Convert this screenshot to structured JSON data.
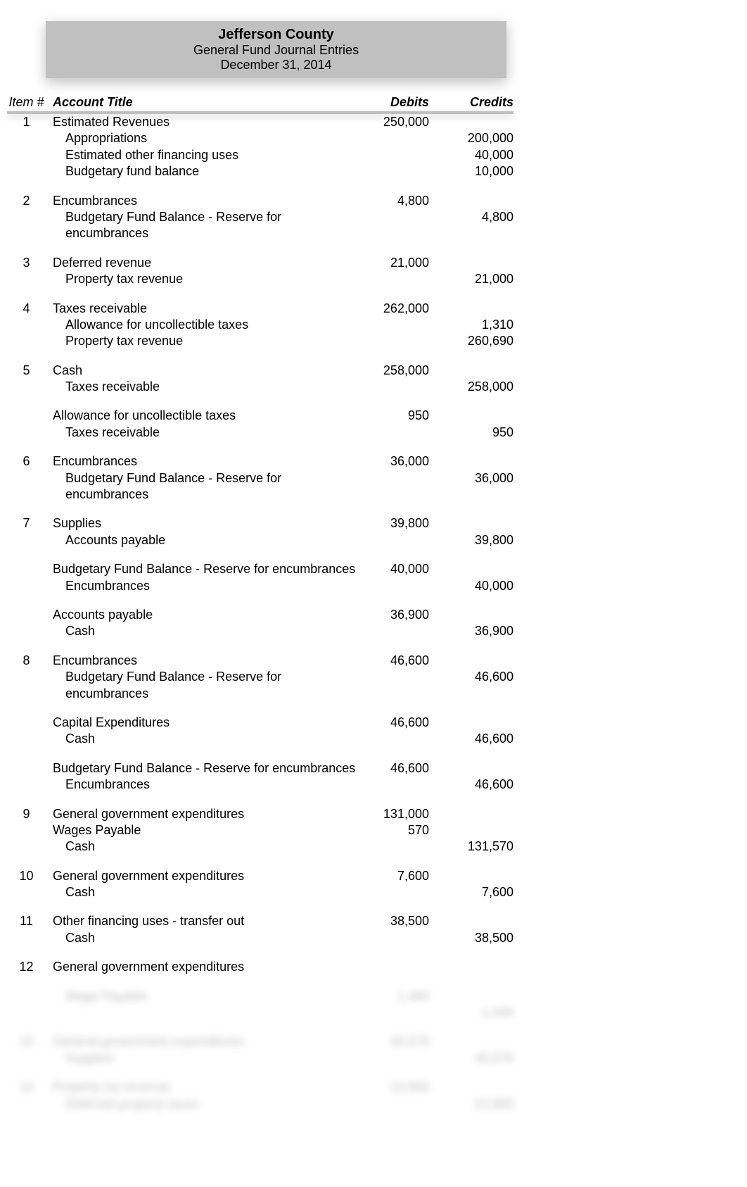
{
  "header": {
    "line1": "Jefferson County",
    "line2": "General Fund Journal Entries",
    "line3": "December 31, 2014"
  },
  "columns": {
    "item": "Item #",
    "title": "Account Title",
    "debit": "Debits",
    "credit": "Credits"
  },
  "entries": [
    {
      "item": "1",
      "rows": [
        {
          "title": "Estimated Revenues",
          "debit": "250,000",
          "credit": "",
          "indent": 0
        },
        {
          "title": "Appropriations",
          "debit": "",
          "credit": "200,000",
          "indent": 1
        },
        {
          "title": "Estimated other financing uses",
          "debit": "",
          "credit": "40,000",
          "indent": 1
        },
        {
          "title": "Budgetary fund balance",
          "debit": "",
          "credit": "10,000",
          "indent": 1
        }
      ]
    },
    {
      "item": "2",
      "rows": [
        {
          "title": "Encumbrances",
          "debit": "4,800",
          "credit": "",
          "indent": 0
        },
        {
          "title": "Budgetary Fund Balance - Reserve for encumbrances",
          "debit": "",
          "credit": "4,800",
          "indent": 1
        }
      ]
    },
    {
      "item": "3",
      "rows": [
        {
          "title": "Deferred revenue",
          "debit": "21,000",
          "credit": "",
          "indent": 0
        },
        {
          "title": "Property tax revenue",
          "debit": "",
          "credit": "21,000",
          "indent": 1
        }
      ]
    },
    {
      "item": "4",
      "rows": [
        {
          "title": "Taxes receivable",
          "debit": "262,000",
          "credit": "",
          "indent": 0
        },
        {
          "title": "Allowance for uncollectible taxes",
          "debit": "",
          "credit": "1,310",
          "indent": 1
        },
        {
          "title": "Property tax revenue",
          "debit": "",
          "credit": "260,690",
          "indent": 1
        }
      ]
    },
    {
      "item": "5",
      "blocks": [
        [
          {
            "title": "Cash",
            "debit": "258,000",
            "credit": "",
            "indent": 0
          },
          {
            "title": "Taxes receivable",
            "debit": "",
            "credit": "258,000",
            "indent": 1
          }
        ],
        [
          {
            "title": "Allowance for uncollectible taxes",
            "debit": "950",
            "credit": "",
            "indent": 0
          },
          {
            "title": "Taxes receivable",
            "debit": "",
            "credit": "950",
            "indent": 1
          }
        ]
      ]
    },
    {
      "item": "6",
      "rows": [
        {
          "title": "Encumbrances",
          "debit": "36,000",
          "credit": "",
          "indent": 0
        },
        {
          "title": "Budgetary Fund Balance - Reserve for encumbrances",
          "debit": "",
          "credit": "36,000",
          "indent": 1
        }
      ]
    },
    {
      "item": "7",
      "blocks": [
        [
          {
            "title": "Supplies",
            "debit": "39,800",
            "credit": "",
            "indent": 0
          },
          {
            "title": "Accounts payable",
            "debit": "",
            "credit": "39,800",
            "indent": 1
          }
        ],
        [
          {
            "title": "Budgetary Fund Balance - Reserve for encumbrances",
            "debit": "40,000",
            "credit": "",
            "indent": 0
          },
          {
            "title": "Encumbrances",
            "debit": "",
            "credit": "40,000",
            "indent": 1
          }
        ],
        [
          {
            "title": "Accounts payable",
            "debit": "36,900",
            "credit": "",
            "indent": 0
          },
          {
            "title": "Cash",
            "debit": "",
            "credit": "36,900",
            "indent": 1
          }
        ]
      ]
    },
    {
      "item": "8",
      "blocks": [
        [
          {
            "title": "Encumbrances",
            "debit": "46,600",
            "credit": "",
            "indent": 0
          },
          {
            "title": "Budgetary Fund Balance - Reserve for encumbrances",
            "debit": "",
            "credit": "46,600",
            "indent": 1
          }
        ],
        [
          {
            "title": "Capital Expenditures",
            "debit": "46,600",
            "credit": "",
            "indent": 0
          },
          {
            "title": "Cash",
            "debit": "",
            "credit": "46,600",
            "indent": 1
          }
        ],
        [
          {
            "title": "Budgetary Fund Balance - Reserve for encumbrances",
            "debit": "46,600",
            "credit": "",
            "indent": 0
          },
          {
            "title": "Encumbrances",
            "debit": "",
            "credit": "46,600",
            "indent": 1
          }
        ]
      ]
    },
    {
      "item": "9",
      "rows": [
        {
          "title": "General government expenditures",
          "debit": "131,000",
          "credit": "",
          "indent": 0
        },
        {
          "title": "Wages Payable",
          "debit": "570",
          "credit": "",
          "indent": 0
        },
        {
          "title": "Cash",
          "debit": "",
          "credit": "131,570",
          "indent": 1
        }
      ]
    },
    {
      "item": "10",
      "rows": [
        {
          "title": "General government expenditures",
          "debit": "7,600",
          "credit": "",
          "indent": 0
        },
        {
          "title": "Cash",
          "debit": "",
          "credit": "7,600",
          "indent": 1
        }
      ]
    },
    {
      "item": "11",
      "rows": [
        {
          "title": "Other financing uses - transfer out",
          "debit": "38,500",
          "credit": "",
          "indent": 0
        },
        {
          "title": "Cash",
          "debit": "",
          "credit": "38,500",
          "indent": 1
        }
      ]
    },
    {
      "item": "12",
      "rows": [
        {
          "title": "General government expenditures",
          "debit": "",
          "credit": "",
          "indent": 0
        }
      ]
    }
  ],
  "blurred_entries": [
    {
      "item": "12",
      "rows": [
        {
          "title": "Wage Payable",
          "debit": "1,400",
          "credit": "",
          "indent": 1
        },
        {
          "title": "",
          "debit": "",
          "credit": "1,400",
          "indent": 1
        }
      ]
    },
    {
      "item": "13",
      "rows": [
        {
          "title": "General government expenditures",
          "debit": "40,570",
          "credit": "",
          "indent": 0
        },
        {
          "title": "Supplies",
          "debit": "",
          "credit": "40,570",
          "indent": 1
        }
      ]
    },
    {
      "item": "14",
      "rows": [
        {
          "title": "Property tax revenue",
          "debit": "23,900",
          "credit": "",
          "indent": 0
        },
        {
          "title": "Deferred property taxes",
          "debit": "",
          "credit": "23,900",
          "indent": 1
        }
      ]
    }
  ]
}
